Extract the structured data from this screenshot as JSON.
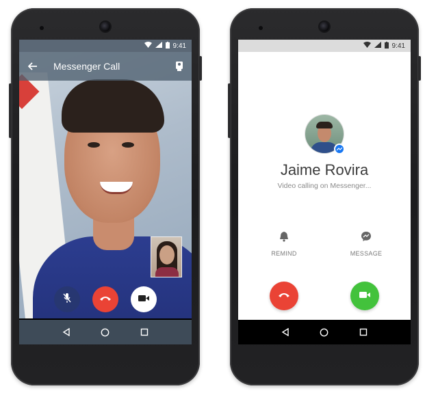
{
  "left_phone": {
    "status_bar": {
      "time": "9:41"
    },
    "app_bar": {
      "title": "Messenger Call"
    },
    "controls": {
      "mute": "mic-off-icon",
      "end": "end-call-icon",
      "video": "video-camera-icon"
    }
  },
  "right_phone": {
    "status_bar": {
      "time": "9:41"
    },
    "caller": {
      "name": "Jaime Rovira",
      "status": "Video calling on Messenger..."
    },
    "actions": {
      "remind_label": "REMIND",
      "message_label": "MESSAGE"
    }
  },
  "colors": {
    "end_call": "#ea4335",
    "accept_call": "#43c23c",
    "messenger_blue": "#1877f2"
  }
}
